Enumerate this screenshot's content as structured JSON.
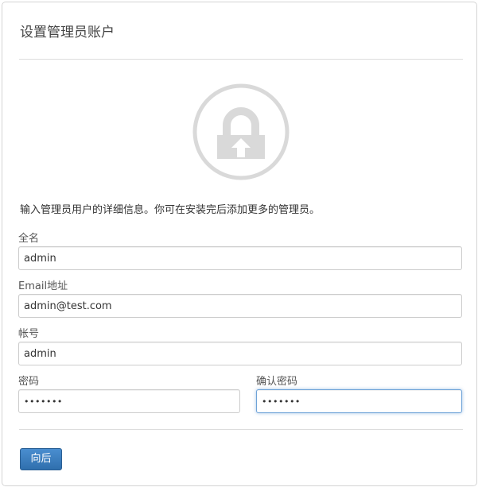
{
  "header": {
    "title": "设置管理员账户"
  },
  "intro_text": "输入管理员用户的详细信息。你可在安装完后添加更多的管理员。",
  "icon": "lock-upload-icon",
  "form": {
    "fullname": {
      "label": "全名",
      "value": "admin"
    },
    "email": {
      "label": "Email地址",
      "value": "admin@test.com"
    },
    "username": {
      "label": "帐号",
      "value": "admin"
    },
    "password": {
      "label": "密码",
      "value": "•••••••"
    },
    "password_confirm": {
      "label": "确认密码",
      "value": "•••••••"
    }
  },
  "actions": {
    "back_label": "向后"
  },
  "colors": {
    "primary_button": "#3a7fc1",
    "icon_gray": "#d9d9d9",
    "focus_border": "#6ea3d8"
  }
}
